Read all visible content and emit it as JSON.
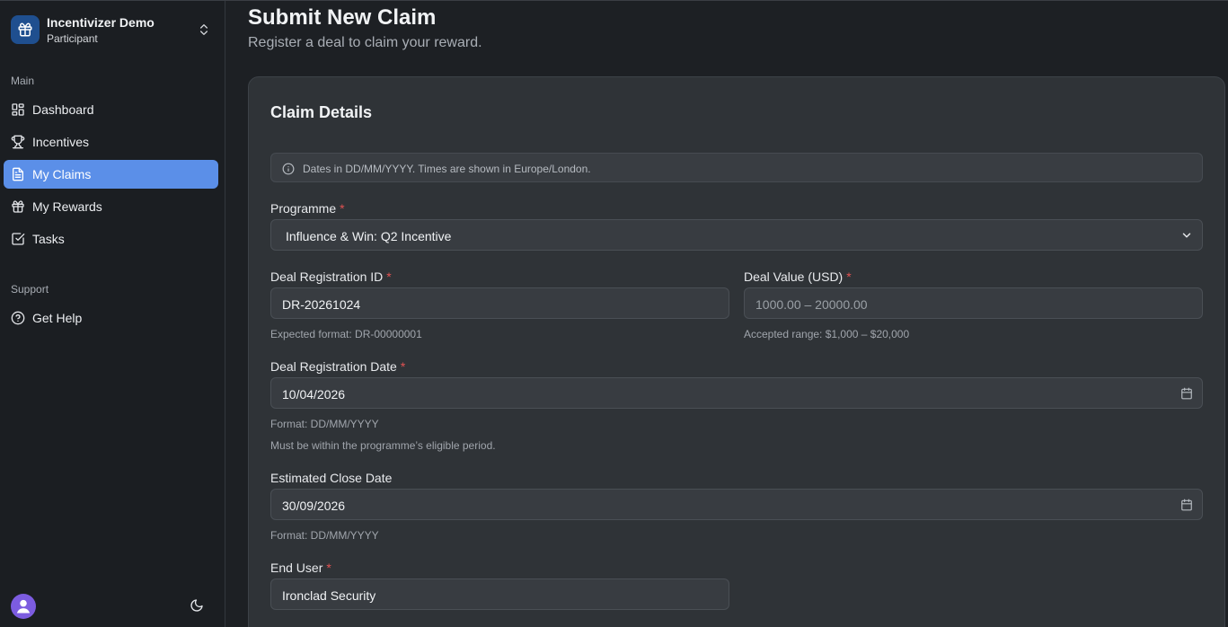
{
  "workspace": {
    "name": "Incentivizer Demo",
    "role": "Participant",
    "logo_icon": "gift-icon",
    "switch_icon": "chevrons-up-down-icon"
  },
  "sidebar": {
    "main_label": "Main",
    "items": [
      {
        "label": "Dashboard",
        "icon": "dashboard-icon"
      },
      {
        "label": "Incentives",
        "icon": "trophy-icon"
      },
      {
        "label": "My Claims",
        "icon": "document-icon",
        "active": true
      },
      {
        "label": "My Rewards",
        "icon": "gift-icon"
      },
      {
        "label": "Tasks",
        "icon": "check-square-icon"
      }
    ],
    "support_label": "Support",
    "support_items": [
      {
        "label": "Get Help",
        "icon": "help-circle-icon"
      }
    ],
    "footer": {
      "avatar_icon": "user-icon",
      "theme_icon": "moon-icon"
    }
  },
  "page": {
    "title": "Submit New Claim",
    "subtitle": "Register a deal to claim your reward."
  },
  "form": {
    "card_title": "Claim Details",
    "info_note": "Dates in DD/MM/YYYY. Times are shown in Europe/London.",
    "programme": {
      "label": "Programme",
      "required_mark": "*",
      "value": "Influence & Win: Q2 Incentive"
    },
    "deal_registration_id": {
      "label": "Deal Registration ID",
      "required_mark": "*",
      "value": "DR-20261024",
      "help": "Expected format: DR-00000001"
    },
    "deal_value": {
      "label": "Deal Value (USD)",
      "required_mark": "*",
      "placeholder": "1000.00 – 20000.00",
      "help": "Accepted range: $1,000 – $20,000"
    },
    "deal_registration_date": {
      "label": "Deal Registration Date",
      "required_mark": "*",
      "value": "10/04/2026",
      "help": "Format: DD/MM/YYYY",
      "help2": "Must be within the programme’s eligible period."
    },
    "estimated_close_date": {
      "label": "Estimated Close Date",
      "value": "30/09/2026",
      "help": "Format: DD/MM/YYYY"
    },
    "end_user": {
      "label": "End User",
      "required_mark": "*",
      "value": "Ironclad Security"
    }
  },
  "colors": {
    "accent": "#5b8fe8",
    "required": "#e05252",
    "avatar": "#7c5ce0"
  }
}
